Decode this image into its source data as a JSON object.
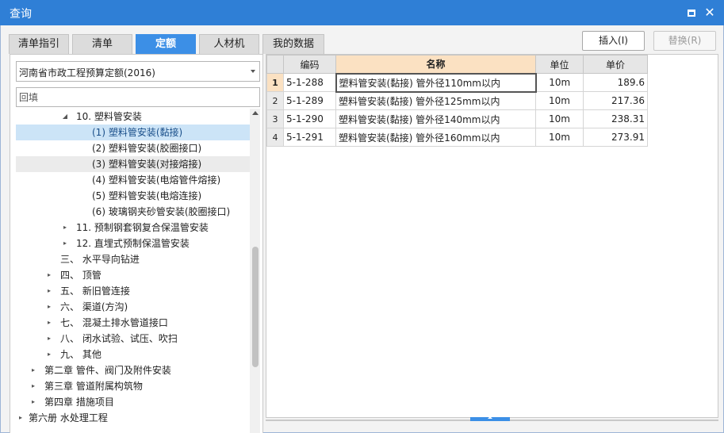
{
  "window": {
    "title": "查询"
  },
  "tabs": [
    {
      "label": "清单指引"
    },
    {
      "label": "清单"
    },
    {
      "label": "定额"
    },
    {
      "label": "人材机"
    },
    {
      "label": "我的数据"
    }
  ],
  "toolbar": {
    "insert_label": "插入(I)",
    "replace_label": "替换(R)"
  },
  "left": {
    "library_select": "河南省市政工程预算定额(2016)",
    "filter_placeholder": "回填"
  },
  "tree": [
    {
      "toggle": "◢",
      "label": "10. 塑料管安装"
    },
    {
      "toggle": "",
      "label": "(1) 塑料管安装(黏接)"
    },
    {
      "toggle": "",
      "label": "(2) 塑料管安装(胶圈接口)"
    },
    {
      "toggle": "",
      "label": "(3) 塑料管安装(对接熔接)"
    },
    {
      "toggle": "",
      "label": "(4) 塑料管安装(电熔管件熔接)"
    },
    {
      "toggle": "",
      "label": "(5) 塑料管安装(电熔连接)"
    },
    {
      "toggle": "",
      "label": "(6) 玻璃钢夹砂管安装(胶圈接口)"
    },
    {
      "toggle": "▸",
      "label": "11. 预制钢套钢复合保温管安装"
    },
    {
      "toggle": "▸",
      "label": "12. 直埋式预制保温管安装"
    },
    {
      "toggle": "",
      "label": "三、 水平导向钻进"
    },
    {
      "toggle": "▸",
      "label": "四、 顶管"
    },
    {
      "toggle": "▸",
      "label": "五、 新旧管连接"
    },
    {
      "toggle": "▸",
      "label": "六、 渠道(方沟)"
    },
    {
      "toggle": "▸",
      "label": "七、 混凝土排水管道接口"
    },
    {
      "toggle": "▸",
      "label": "八、 闭水试验、试压、吹扫"
    },
    {
      "toggle": "▸",
      "label": "九、 其他"
    },
    {
      "toggle": "▸",
      "label": "第二章 管件、阀门及附件安装"
    },
    {
      "toggle": "▸",
      "label": "第三章 管道附属构筑物"
    },
    {
      "toggle": "▸",
      "label": "第四章 措施项目"
    },
    {
      "toggle": "▸",
      "label": "第六册 水处理工程"
    }
  ],
  "table": {
    "headers": [
      "",
      "编码",
      "名称",
      "单位",
      "单价"
    ],
    "rows": [
      [
        "1",
        "5-1-288",
        "塑料管安装(黏接) 管外径110mm以内",
        "10m",
        "189.6"
      ],
      [
        "2",
        "5-1-289",
        "塑料管安装(黏接) 管外径125mm以内",
        "10m",
        "217.36"
      ],
      [
        "3",
        "5-1-290",
        "塑料管安装(黏接) 管外径140mm以内",
        "10m",
        "238.31"
      ],
      [
        "4",
        "5-1-291",
        "塑料管安装(黏接) 管外径160mm以内",
        "10m",
        "273.91"
      ]
    ]
  },
  "colors": {
    "accent": "#3c8fe6",
    "titlebar": "#2f7fd6",
    "selected_row": "#cce4f7",
    "header_highlight": "#fbe1c2"
  }
}
